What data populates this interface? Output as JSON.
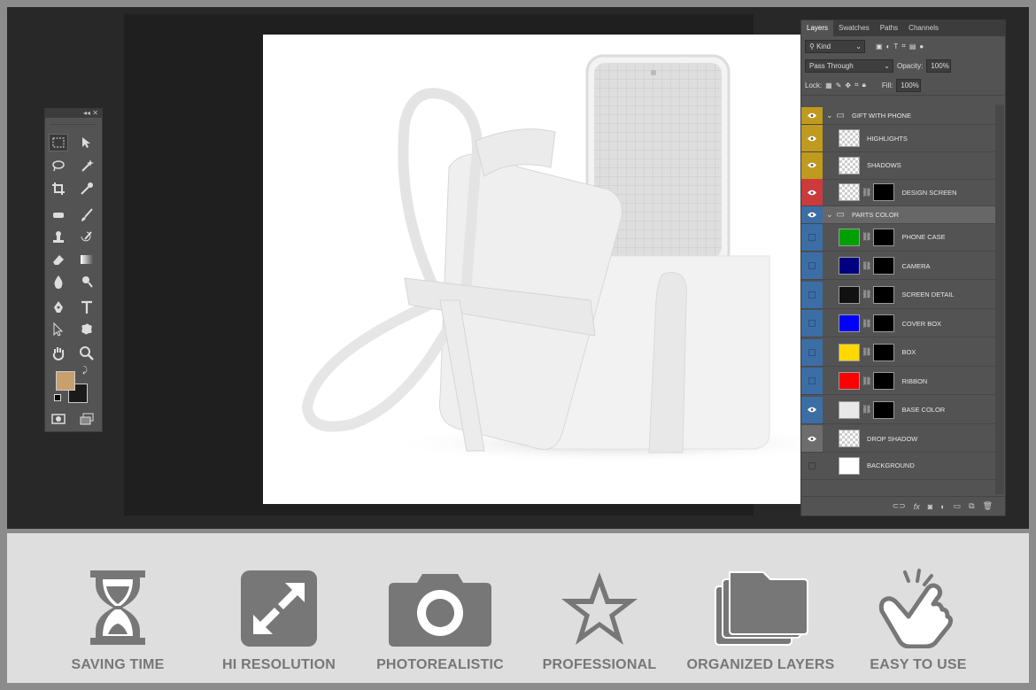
{
  "panel": {
    "tabs": [
      "Layers",
      "Swatches",
      "Paths",
      "Channels"
    ],
    "filter_kind": "Kind",
    "blend_mode": "Pass Through",
    "opacity_label": "Opacity:",
    "opacity_value": "100%",
    "lock_label": "Lock:",
    "fill_label": "Fill:",
    "fill_value": "100%"
  },
  "layers": [
    {
      "name": "GIFT WITH PHONE",
      "type": "group",
      "eye_color": "#c09a1e",
      "visible": true
    },
    {
      "name": "HIGHLIGHTS",
      "type": "layer",
      "eye_color": "#c09a1e",
      "visible": true
    },
    {
      "name": "SHADOWS",
      "type": "layer",
      "eye_color": "#c09a1e",
      "visible": true
    },
    {
      "name": "DESIGN SCREEN",
      "type": "smart",
      "eye_color": "#cc3b3b",
      "visible": true
    },
    {
      "name": "PARTS COLOR",
      "type": "group",
      "eye_color": "#3c6ea6",
      "visible": true
    },
    {
      "name": "PHONE CASE",
      "type": "fill",
      "swatch": "#00a000",
      "eye_color": "#3c6ea6",
      "visible": false
    },
    {
      "name": "CAMERA",
      "type": "fill",
      "swatch": "#000080",
      "eye_color": "#3c6ea6",
      "visible": false
    },
    {
      "name": "SCREEN DETAIL",
      "type": "fill",
      "swatch": "#111111",
      "eye_color": "#3c6ea6",
      "visible": false
    },
    {
      "name": "COVER BOX",
      "type": "fill",
      "swatch": "#0000ff",
      "eye_color": "#3c6ea6",
      "visible": false
    },
    {
      "name": "BOX",
      "type": "fill",
      "swatch": "#ffd800",
      "eye_color": "#3c6ea6",
      "visible": false
    },
    {
      "name": "RIBBON",
      "type": "fill",
      "swatch": "#ff0000",
      "eye_color": "#3c6ea6",
      "visible": false
    },
    {
      "name": "BASE COLOR",
      "type": "fill",
      "swatch": "#e8e8e8",
      "eye_color": "#3c6ea6",
      "visible": true
    },
    {
      "name": "DROP SHADOW",
      "type": "transparent",
      "eye_color": "#6d6d6d",
      "visible": true
    },
    {
      "name": "BACKGROUND",
      "type": "white",
      "eye_color": "#535353",
      "visible": false
    }
  ],
  "toolbox": {
    "foreground_color": "#c8a06c",
    "background_color": "#1a1a1a"
  },
  "features": [
    {
      "label": "SAVING TIME",
      "icon": "hourglass-icon"
    },
    {
      "label": "HI RESOLUTION",
      "icon": "expand-arrows-icon"
    },
    {
      "label": "PHOTOREALISTIC",
      "icon": "camera-icon"
    },
    {
      "label": "PROFESSIONAL",
      "icon": "star-icon"
    },
    {
      "label": "ORGANIZED LAYERS",
      "icon": "folders-icon"
    },
    {
      "label": "EASY TO USE",
      "icon": "tap-hand-icon"
    }
  ]
}
